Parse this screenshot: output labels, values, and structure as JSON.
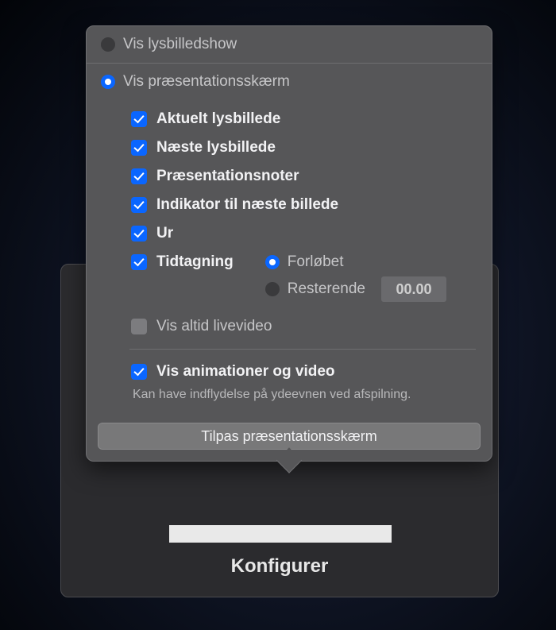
{
  "backpanel": {
    "button_label": "Konfigurer"
  },
  "popover": {
    "radio_slideshow": "Vis lysbilledshow",
    "radio_presenter": "Vis præsentationsskærm",
    "checks": {
      "current": "Aktuelt lysbillede",
      "next": "Næste lysbillede",
      "notes": "Præsentationsnoter",
      "indicator": "Indikator til næste billede",
      "clock": "Ur",
      "timing": "Tidtagning",
      "live": "Vis altid livevideo",
      "anim": "Vis animationer og video"
    },
    "timing_mode": {
      "elapsed": "Forløbet",
      "remaining": "Resterende",
      "time_value": "00.00"
    },
    "anim_hint": "Kan have indflydelse på ydeevnen ved afspilning.",
    "customize_button": "Tilpas præsentationsskærm"
  }
}
